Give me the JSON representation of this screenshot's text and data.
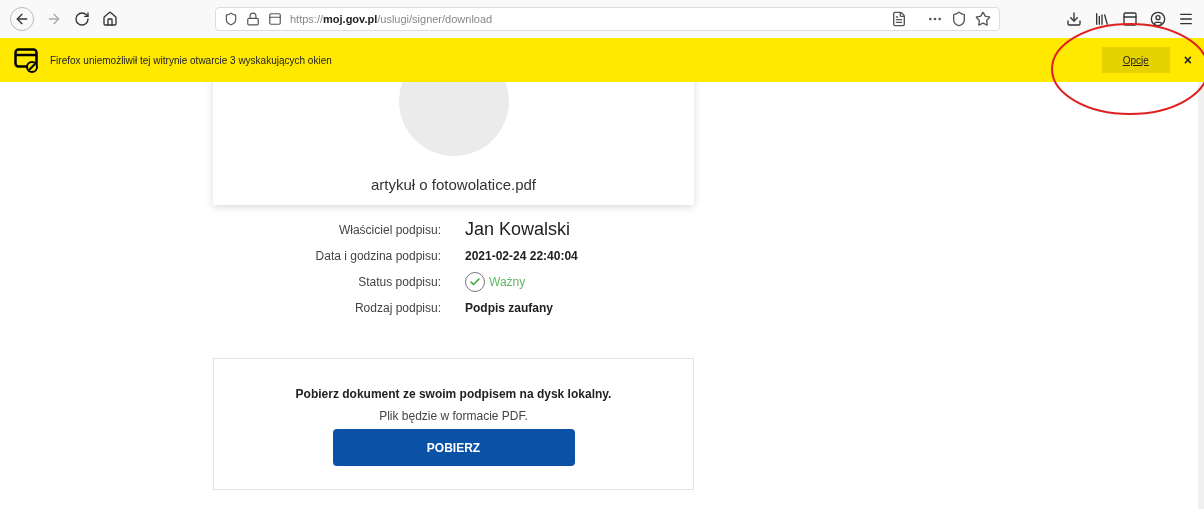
{
  "toolbar": {
    "url": "https://**moj.gov.pl**/uslugi/signer/download"
  },
  "notification": {
    "message": "Firefox uniemożliwił tej witrynie otwarcie 3 wyskakujących okien",
    "options_button": "Opcje",
    "close": "×",
    "highlighted": true
  },
  "file_card": {
    "file_name": "artykuł o fotowolatice.pdf"
  },
  "details": [
    {
      "kind": "name",
      "label": "Właściciel podpisu:",
      "value": "Jan Kowalski"
    },
    {
      "kind": "bold",
      "label": "Data i godzina podpisu:",
      "value": "2021-02-24 22:40:04"
    },
    {
      "kind": "status",
      "label": "Status podpisu:",
      "value": "Ważny",
      "valid": true
    },
    {
      "kind": "bold",
      "label": "Rodzaj podpisu:",
      "value": "Podpis zaufany"
    }
  ],
  "download_card": {
    "heading": "Pobierz dokument ze swoim podpisem na dysk lokalny.",
    "note": "Plik będzie w formacie PDF.",
    "button": "POBIERZ"
  }
}
